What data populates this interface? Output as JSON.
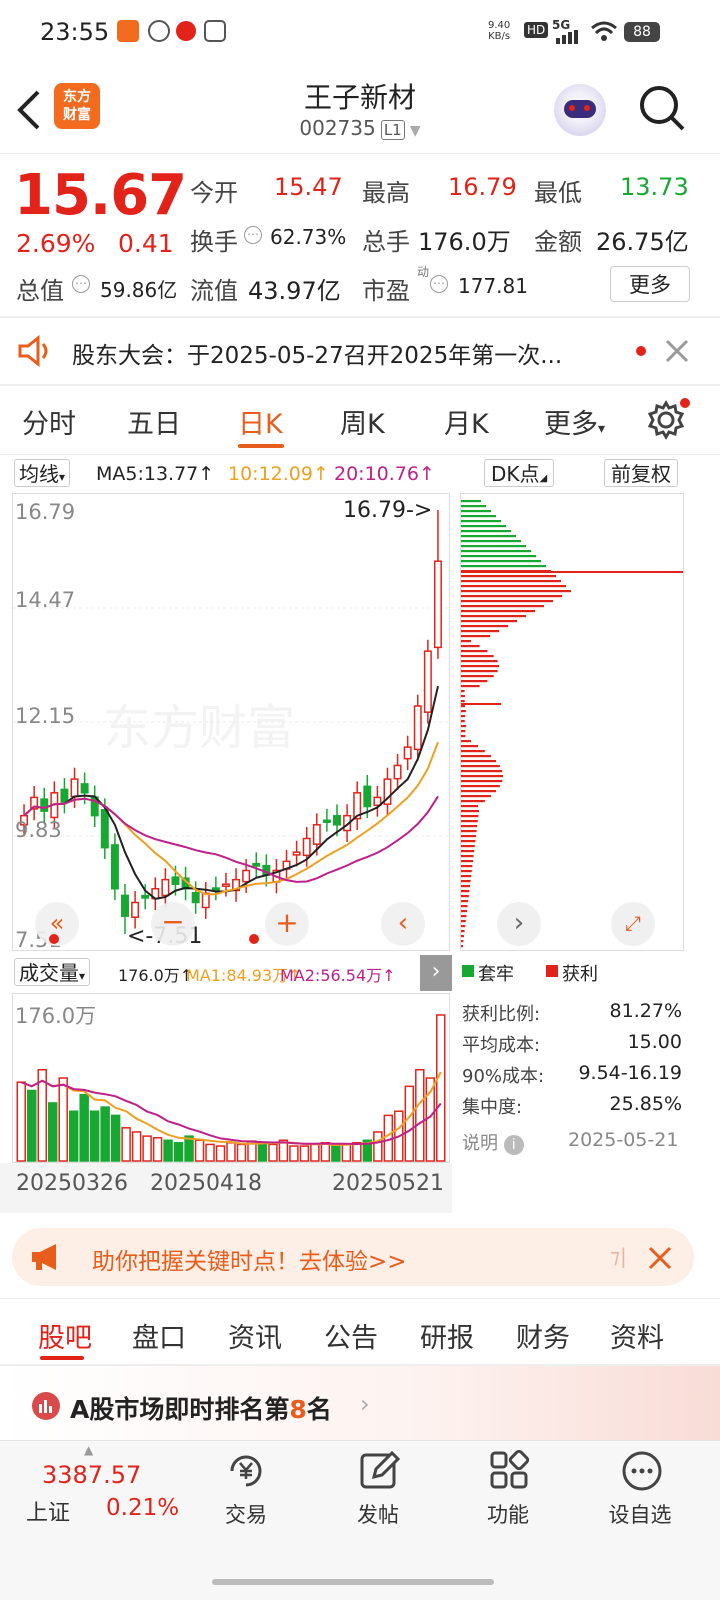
{
  "status_bar": {
    "time": "23:55",
    "net_speed_top": "9.40",
    "net_speed_unit": "KB/s",
    "hd": "HD",
    "signal": "5G",
    "battery": "88"
  },
  "header": {
    "title": "王子新材",
    "code": "002735",
    "level": "L1",
    "logo_line1": "东方",
    "logo_line2": "财富"
  },
  "quote": {
    "price": "15.67",
    "change_pct": "2.69%",
    "change_amt": "0.41",
    "open_label": "今开",
    "open": "15.47",
    "high_label": "最高",
    "high": "16.79",
    "low_label": "最低",
    "low": "13.73",
    "turnover_label": "换手",
    "turnover": "62.73%",
    "volume_label": "总手",
    "volume": "176.0万",
    "amount_label": "金额",
    "amount": "26.75亿",
    "mktcap_label": "总值",
    "mktcap": "59.86亿",
    "float_label": "流值",
    "float_cap": "43.97亿",
    "pe_label": "市盈",
    "pe_sup": "动",
    "pe": "177.81",
    "more_label": "更多"
  },
  "notice": {
    "text": "股东大会：于2025-05-27召开2025年第一次..."
  },
  "chart_tabs": [
    "分时",
    "五日",
    "日K",
    "周K",
    "月K",
    "更多"
  ],
  "active_chart_tab": "日K",
  "ma_bar": {
    "selector": "均线",
    "ma5": "MA5:13.77↑",
    "ma10": "10:12.09↑",
    "ma20": "20:10.76↑",
    "dk_label": "DK点",
    "adjust_label": "前复权"
  },
  "kline": {
    "y_labels": [
      "16.79",
      "14.47",
      "12.15",
      "9.83",
      "7.51"
    ],
    "max_marker": "16.79->",
    "min_marker": "<-7.51",
    "watermark": "东方财富"
  },
  "volume_bar": {
    "selector": "成交量",
    "vol": "176.0万↑",
    "ma1": "MA1:84.93万↑",
    "ma2": "MA2:56.54万↑",
    "y_max": "176.0万",
    "dates": [
      "20250326",
      "20250418",
      "20250521"
    ]
  },
  "chip": {
    "legend_trapped": "套牢",
    "legend_profit": "获利",
    "rows": [
      {
        "label": "获利比例:",
        "value": "81.27%"
      },
      {
        "label": "平均成本:",
        "value": "15.00"
      },
      {
        "label": "90%成本:",
        "value": "9.54-16.19"
      },
      {
        "label": "集中度:",
        "value": "25.85%"
      }
    ],
    "explain_label": "说明",
    "date": "2025-05-21"
  },
  "promo": {
    "text": "助你把握关键时点！去体验>>"
  },
  "news_tabs": [
    "股吧",
    "盘口",
    "资讯",
    "公告",
    "研报",
    "财务",
    "资料"
  ],
  "active_news_tab": "股吧",
  "ranking": {
    "prefix": "A股市场即时排名第",
    "rank": "8",
    "suffix": "名"
  },
  "bottom_nav": {
    "index_value": "3387.57",
    "index_name": "上证",
    "index_pct": "0.21%",
    "items": [
      "交易",
      "发帖",
      "功能",
      "设自选"
    ]
  },
  "colors": {
    "up": "#e2231a",
    "down": "#17a832",
    "accent": "#e85d1c",
    "ma5": "#222222",
    "ma10": "#f0a020",
    "ma20": "#c0208a"
  }
}
